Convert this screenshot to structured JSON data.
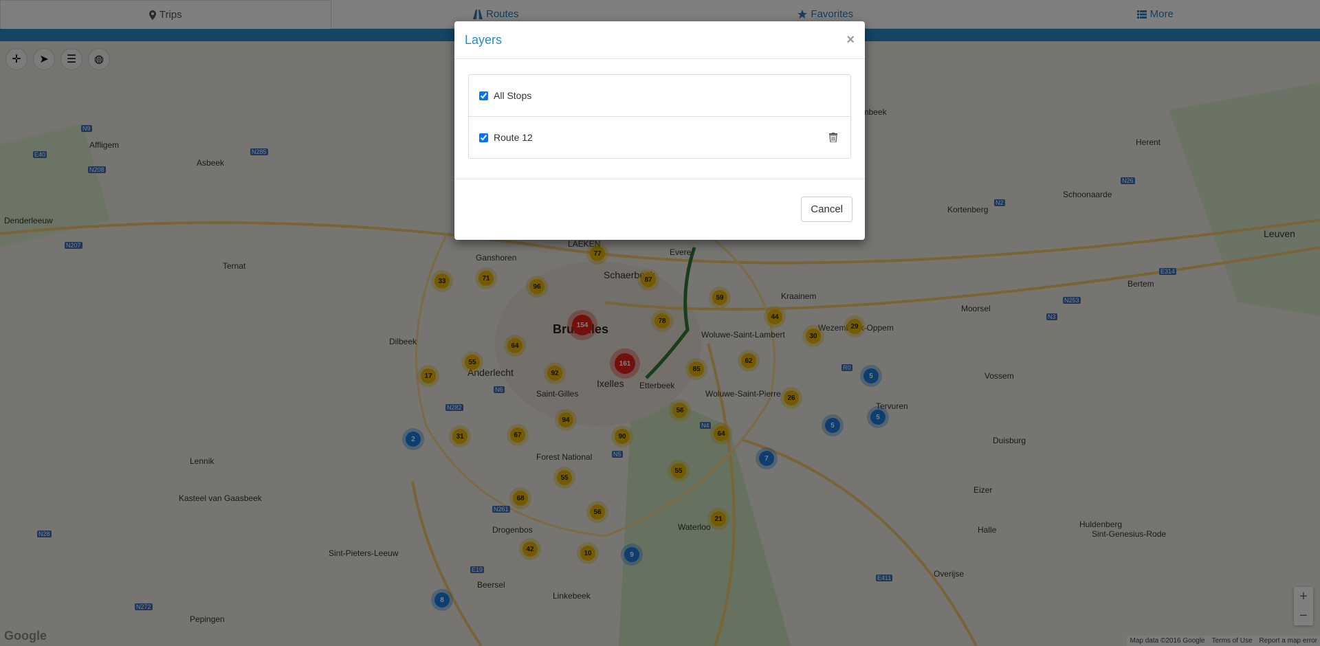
{
  "nav": {
    "tabs": [
      {
        "label": "Trips",
        "icon": "map-marker-icon",
        "active": true
      },
      {
        "label": "Routes",
        "icon": "road-icon",
        "active": false
      },
      {
        "label": "Favorites",
        "icon": "star-icon",
        "active": false
      },
      {
        "label": "More",
        "icon": "list-icon",
        "active": false
      }
    ]
  },
  "map": {
    "tools": [
      "crosshair-icon",
      "paper-plane-icon",
      "layers-stack-icon",
      "globe-icon"
    ],
    "places": {
      "bruxelles": "Bruxelles",
      "leuven": "Leuven",
      "anderlecht": "Anderlecht",
      "ixelles": "Ixelles",
      "schaerbeek": "Schaerbeek",
      "etterbeek": "Etterbeek",
      "denderleeuw": "Denderleeuw",
      "waterloo": "Waterloo",
      "tervuren": "Tervuren",
      "wezembeek": "Wezembeek-Oppem",
      "kraainem": "Kraainem",
      "forest": "Forest National",
      "dilbeek": "Dilbeek",
      "asbeek": "Asbeek",
      "ternat": "Ternat",
      "beersel": "Beersel",
      "linkebeek": "Linkebeek",
      "drogenbos": "Drogenbos",
      "overijse": "Overijse",
      "huldenberg": "Huldenberg",
      "kortenberg": "Kortenberg",
      "vossem": "Vossem",
      "wambeek": "Wambeek",
      "herent": "Herent",
      "moorsel": "Moorsel",
      "affligem": "Affligem",
      "lennik": "Lennik",
      "halle": "Halle",
      "stgenesius": "Sint-Genesius-Rode",
      "eizer": "Eizer",
      "duisburg": "Duisburg",
      "bertem": "Bertem",
      "zaventem": "Woluwe-Saint-Lambert",
      "woluwepierre": "Woluwe-Saint-Pierre",
      "saintgilles": "Saint-Gilles",
      "laeken": "LAEKEN",
      "ganshoren": "Ganshoren",
      "evere": "Evere",
      "gaasbeek": "Kasteel van Gaasbeek",
      "sintpieters": "Sint-Pieters-Leeuw",
      "schoonaarde": "Schoonaarde",
      "pepingen": "Pepingen"
    },
    "roads": {
      "n9": "N9",
      "n285": "N285",
      "n208": "N208",
      "e40a": "E40",
      "n207": "N207",
      "r0": "R0",
      "n4": "N4",
      "e411": "E411",
      "n253": "N253",
      "n3": "N3",
      "n26": "N26",
      "n2": "N2",
      "e314": "E314",
      "n5": "N5",
      "n6": "N6",
      "n282": "N282",
      "n28": "N28",
      "n272": "N272",
      "e19": "E19",
      "n261": "N261"
    },
    "clusters": {
      "c154": "154",
      "c161": "161",
      "c77": "77",
      "c87": "87",
      "c33": "33",
      "c71": "71",
      "c96": "96",
      "c78": "78",
      "c59": "59",
      "c44": "44",
      "c30": "30",
      "c29": "29",
      "c64a": "64",
      "c55a": "55",
      "c17": "17",
      "c92": "92",
      "c85": "85",
      "c62": "62",
      "c26": "26",
      "c56a": "56",
      "c94": "94",
      "c67": "67",
      "c31": "31",
      "c90": "90",
      "c64b": "64",
      "c55b": "55",
      "c55c": "55",
      "c68": "68",
      "c56b": "56",
      "c21": "21",
      "c42": "42",
      "c10": "10",
      "b2": "2",
      "b7": "7",
      "b5a": "5",
      "b5b": "5",
      "b5c": "5",
      "b9": "9",
      "b8": "8"
    },
    "zoom_in": "+",
    "zoom_out": "−",
    "attribution": {
      "map_data": "Map data ©2016 Google",
      "terms": "Terms of Use",
      "report": "Report a map error"
    },
    "logo": "Google"
  },
  "modal": {
    "title": "Layers",
    "close": "×",
    "layers": [
      {
        "label": "All Stops",
        "checked": true,
        "deletable": false
      },
      {
        "label": "Route 12",
        "checked": true,
        "deletable": true
      }
    ],
    "cancel_label": "Cancel"
  }
}
